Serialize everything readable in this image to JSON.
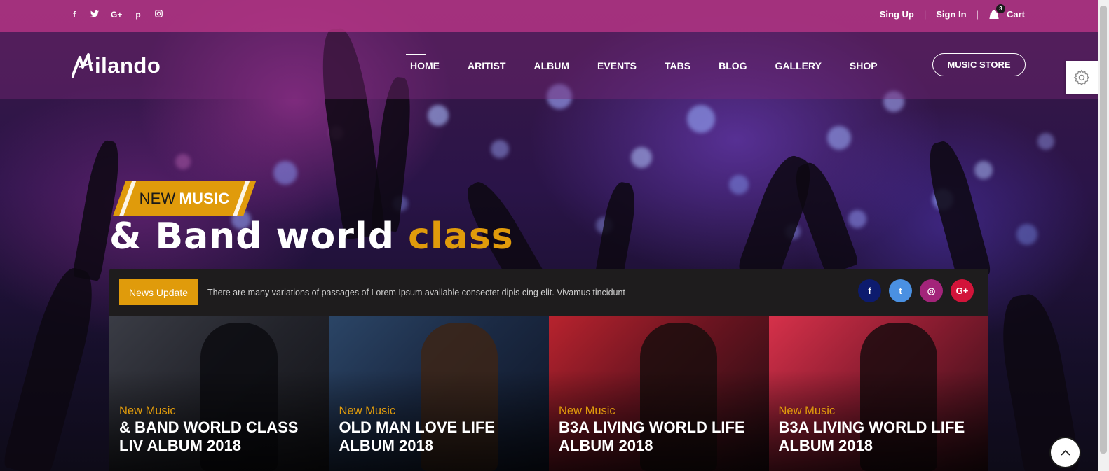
{
  "topbar": {
    "social_icons": [
      "facebook-icon",
      "twitter-icon",
      "google-plus-icon",
      "pinterest-icon",
      "instagram-icon"
    ],
    "social_glyphs": [
      "f",
      "t",
      "G+",
      "p",
      "◎"
    ],
    "sign_up": "Sing Up",
    "sign_in": "Sign In",
    "cart_label": "Cart",
    "cart_count": "3",
    "background_color": "#b23484"
  },
  "header": {
    "logo_text": "ilando",
    "nav": [
      {
        "label": "HOME",
        "active": true
      },
      {
        "label": "ARITIST",
        "active": false
      },
      {
        "label": "ALBUM",
        "active": false
      },
      {
        "label": "EVENTS",
        "active": false
      },
      {
        "label": "TABS",
        "active": false
      },
      {
        "label": "BLOG",
        "active": false
      },
      {
        "label": "GALLERY",
        "active": false
      },
      {
        "label": "SHOP",
        "active": false
      }
    ],
    "store_button": "MUSIC STORE",
    "settings_icon": "gear-icon"
  },
  "hero": {
    "badge_part1": "NEW",
    "badge_part2": "MUSIC",
    "title_main": "& Band world",
    "title_accent": "class",
    "accent_color": "#e09b0b"
  },
  "news": {
    "label": "News Update",
    "text": "There are many variations of passages of Lorem Ipsum available consectet dipis cing elit. Vivamus tincidunt",
    "social": [
      {
        "icon": "facebook-icon",
        "glyph": "f",
        "color": "#0d1b6e"
      },
      {
        "icon": "twitter-icon",
        "glyph": "t",
        "color": "#4a90e2"
      },
      {
        "icon": "instagram-icon",
        "glyph": "◎",
        "color": "#a3247a"
      },
      {
        "icon": "google-plus-icon",
        "glyph": "G+",
        "color": "#d2143a"
      }
    ]
  },
  "cards": [
    {
      "category": "New Music",
      "title": "& BAND WORLD CLASS LIV ALBUM 2018"
    },
    {
      "category": "New Music",
      "title": "OLD MAN LOVE LIFE ALBUM 2018"
    },
    {
      "category": "New Music",
      "title": "B3A LIVING WORLD LIFE ALBUM 2018"
    },
    {
      "category": "New Music",
      "title": "B3A LIVING WORLD LIFE ALBUM 2018"
    }
  ],
  "back_to_top_icon": "chevron-up-icon"
}
